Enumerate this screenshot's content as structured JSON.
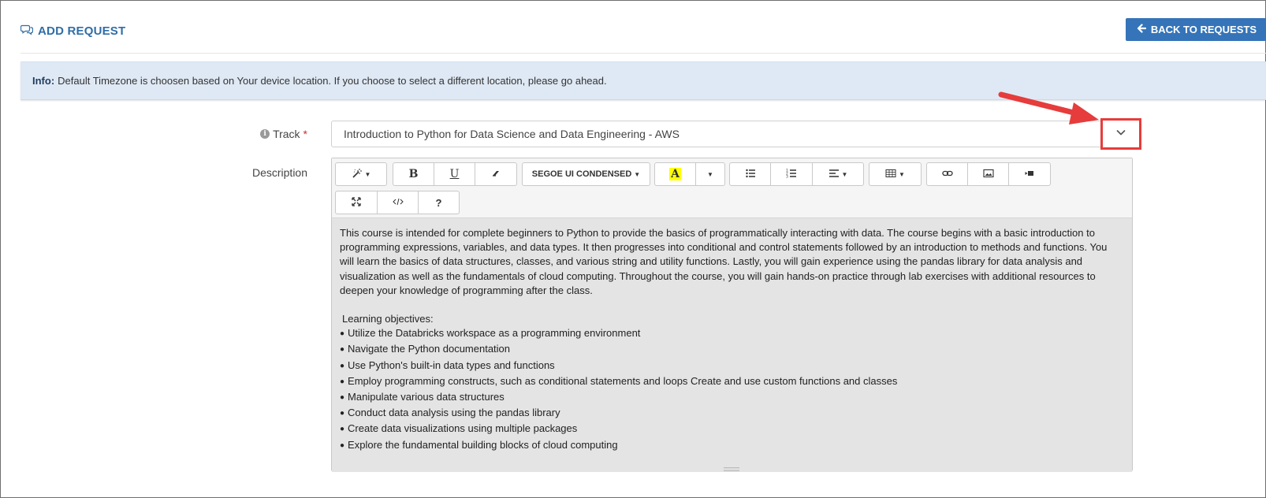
{
  "header": {
    "title": "ADD REQUEST",
    "back_button": "BACK TO REQUESTS"
  },
  "info": {
    "label": "Info:",
    "text": "Default Timezone is choosen based on Your device location. If you choose to select a different location, please go ahead."
  },
  "track": {
    "label": "Track",
    "required_mark": "*",
    "value": "Introduction to Python for Data Science and Data Engineering - AWS"
  },
  "description": {
    "label": "Description",
    "toolbar": {
      "font_name": "SEGOE UI CONDENSED",
      "highlight_letter": "A",
      "bold": "B",
      "underline": "U",
      "help": "?"
    },
    "intro": "This course is intended for complete beginners to Python to provide the basics of programmatically interacting with data. The course begins with a basic introduction to programming expressions, variables, and data types. It then progresses into conditional and control statements followed by an introduction to methods and functions. You will learn the basics of data structures, classes, and various string and utility functions. Lastly, you will gain experience using the pandas library for data analysis and visualization as well as the fundamentals of cloud computing. Throughout the course, you will gain hands-on practice through lab exercises with additional resources to deepen your knowledge of programming after the class.",
    "objectives_heading": "Learning objectives:",
    "objectives": [
      "Utilize the Databricks workspace as a programming environment",
      "Navigate the Python documentation",
      "Use Python's built-in data types and functions",
      "Employ programming constructs, such as conditional statements and loops Create and use custom functions and classes",
      "Manipulate various data structures",
      "Conduct data analysis using the pandas library",
      "Create data visualizations using multiple packages",
      "Explore the fundamental building blocks of cloud computing"
    ]
  },
  "colors": {
    "accent": "#3574b8",
    "annotation": "#e63c3c",
    "info_bg": "#dfe9f5"
  }
}
